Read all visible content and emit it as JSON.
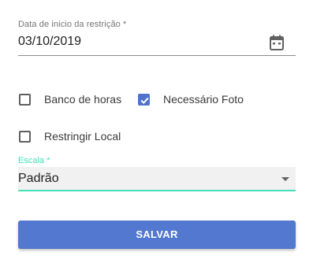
{
  "date_field": {
    "label": "Data de inicio da restrição *",
    "value": "03/10/2019",
    "icon": "calendar-icon"
  },
  "checkboxes": [
    {
      "label": "Banco de horas",
      "checked": false
    },
    {
      "label": "Necessário Foto",
      "checked": true
    },
    {
      "label": "Restringir Local",
      "checked": false
    }
  ],
  "select_field": {
    "label": "Escala *",
    "value": "Padrão",
    "icon": "dropdown-arrow-icon"
  },
  "save_button": {
    "label": "SALVAR"
  },
  "colors": {
    "primary": "#5279cf",
    "accent": "#46e0b8",
    "checkbox_checked": "#4f73c9"
  }
}
